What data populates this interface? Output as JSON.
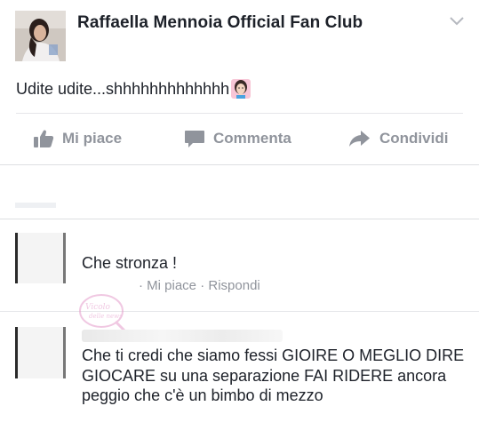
{
  "post": {
    "page_name": "Raffaella Mennoia Official Fan Club",
    "text": "Udite udite...shhhhhhhhhhhhh",
    "menu_icon": "chevron-down-icon",
    "emoji": "woman-shushing-emoji"
  },
  "actions": {
    "like": "Mi piace",
    "comment": "Commenta",
    "share": "Condividi",
    "like_icon": "thumbs-up-icon",
    "comment_icon": "speech-bubble-icon",
    "share_icon": "share-arrow-icon"
  },
  "comments": [
    {
      "text": "Che stronza !",
      "meta_prefix": "·",
      "like": "Mi piace",
      "sep": "·",
      "reply": "Rispondi"
    },
    {
      "text": "Che ti credi che siamo fessi GIOIRE O MEGLIO DIRE GIOCARE su una separazione FAI RIDERE ancora peggio che c'è un bimbo di mezzo"
    }
  ],
  "watermark": {
    "logo": "Vicolo delle news"
  },
  "colors": {
    "text": "#1d2129",
    "muted": "#90949c",
    "divider": "#e5e6e9"
  }
}
